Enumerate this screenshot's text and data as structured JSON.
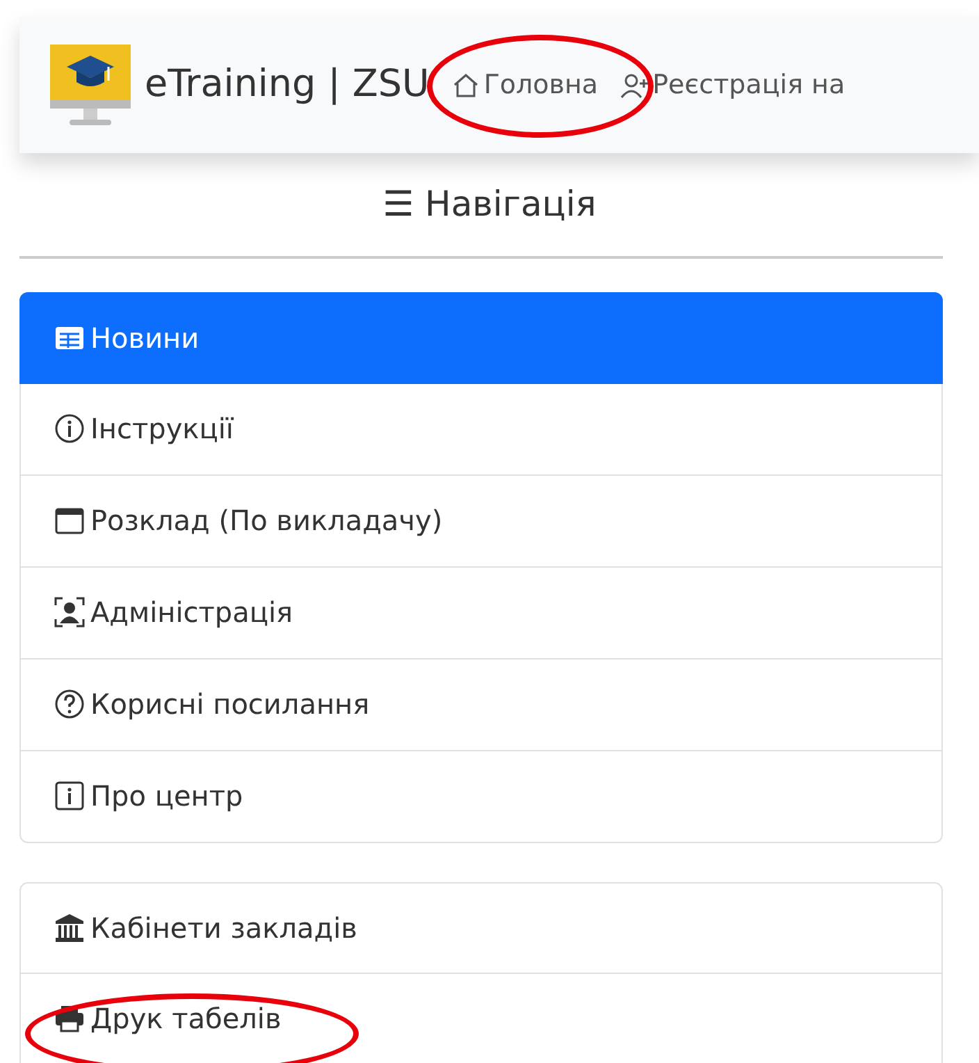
{
  "navbar": {
    "brand": "eTraining | ZSU",
    "links": [
      {
        "label": "Головна",
        "circled": true
      },
      {
        "label": "Реєстрація на",
        "circled": false
      }
    ]
  },
  "heading": {
    "icon_text": "☰",
    "title": "Навігація"
  },
  "menu_groups": [
    {
      "items": [
        {
          "label": "Новини",
          "selected": true,
          "circled": false
        },
        {
          "label": "Інструкції",
          "selected": false,
          "circled": false
        },
        {
          "label": "Розклад (По викладачу)",
          "selected": false,
          "circled": false
        },
        {
          "label": "Адміністрація",
          "selected": false,
          "circled": false
        },
        {
          "label": "Корисні посилання",
          "selected": false,
          "circled": false
        },
        {
          "label": "Про центр",
          "selected": false,
          "circled": false
        }
      ]
    },
    {
      "items": [
        {
          "label": "Кабінети закладів",
          "selected": false,
          "circled": false
        },
        {
          "label": "Друк табелів",
          "selected": false,
          "circled": true
        }
      ]
    }
  ]
}
